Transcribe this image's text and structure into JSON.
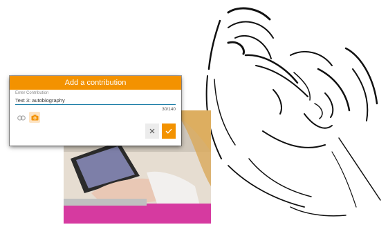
{
  "dialog": {
    "title": "Add a contribution",
    "field_label": "Enter Contribution",
    "field_value": "Text 3: autobiography",
    "char_count": "30/140"
  },
  "icons": {
    "attach": "link-icon",
    "photo": "camera-icon",
    "cancel": "close-icon",
    "confirm": "checkmark-icon"
  },
  "colors": {
    "accent": "#f39200",
    "underline": "#1e7ea8"
  }
}
